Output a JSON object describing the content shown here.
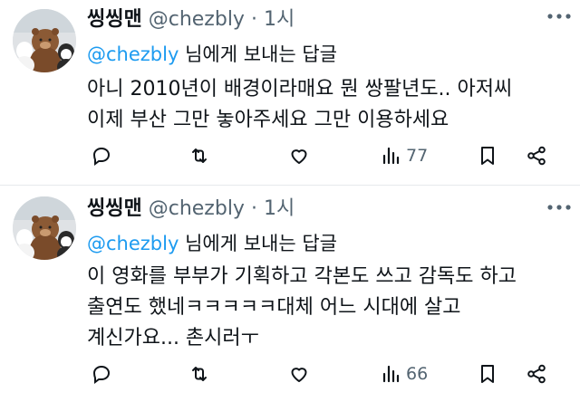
{
  "tweets": [
    {
      "name": "씽씽맨",
      "handle": "@chezbly",
      "dot": "·",
      "time": "1시",
      "reply_mention": "@chezbly",
      "reply_label": " 님에게 보내는 답글",
      "lines": [
        "아니 2010년이 배경이라매요 뭔 쌍팔년도.. 아저씨",
        "이제 부산 그만 놓아주세요 그만 이용하세요"
      ],
      "views": "77"
    },
    {
      "name": "씽씽맨",
      "handle": "@chezbly",
      "dot": "·",
      "time": "1시",
      "reply_mention": "@chezbly",
      "reply_label": " 님에게 보내는 답글",
      "lines": [
        "이 영화를 부부가 기획하고 각본도 쓰고 감독도 하고",
        "출연도 했네ㅋㅋㅋㅋㅋ대체 어느 시대에 살고",
        "계신가요... 촌시러ㅜ"
      ],
      "views": "66"
    }
  ],
  "icons": [
    "more-icon",
    "reply-icon",
    "retweet-icon",
    "like-icon",
    "views-icon",
    "bookmark-icon",
    "share-icon"
  ]
}
